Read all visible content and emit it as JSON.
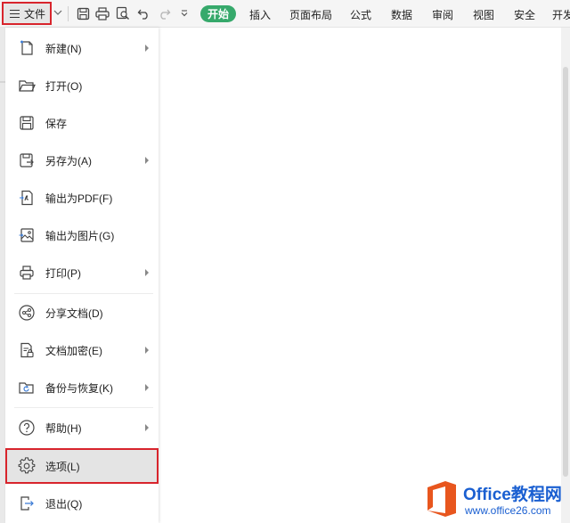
{
  "toolbar": {
    "file_label": "文件",
    "start_tab": "开始",
    "tabs": [
      "插入",
      "页面布局",
      "公式",
      "数据",
      "审阅",
      "视图",
      "安全",
      "开发"
    ],
    "quick_access_icons": [
      "save-icon",
      "print-icon",
      "print-preview-icon",
      "undo-icon",
      "redo-icon",
      "customize-arrow-icon"
    ]
  },
  "file_menu": {
    "items": [
      {
        "label": "新建(N)",
        "icon": "new-file-icon",
        "submenu": true
      },
      {
        "label": "打开(O)",
        "icon": "folder-open-icon",
        "submenu": false
      },
      {
        "label": "保存",
        "icon": "save-icon",
        "submenu": false
      },
      {
        "label": "另存为(A)",
        "icon": "save-as-icon",
        "submenu": true
      },
      {
        "label": "输出为PDF(F)",
        "icon": "export-pdf-icon",
        "submenu": false
      },
      {
        "label": "输出为图片(G)",
        "icon": "export-image-icon",
        "submenu": false
      },
      {
        "label": "打印(P)",
        "icon": "print-icon",
        "submenu": true
      },
      {
        "label": "分享文档(D)",
        "icon": "share-icon",
        "submenu": false
      },
      {
        "label": "文档加密(E)",
        "icon": "encrypt-doc-icon",
        "submenu": true
      },
      {
        "label": "备份与恢复(K)",
        "icon": "backup-restore-icon",
        "submenu": true
      },
      {
        "label": "帮助(H)",
        "icon": "help-icon",
        "submenu": true
      },
      {
        "label": "选项(L)",
        "icon": "gear-icon",
        "submenu": false,
        "selected": true
      },
      {
        "label": "退出(Q)",
        "icon": "exit-icon",
        "submenu": false
      }
    ]
  },
  "watermark": {
    "brand": "Office教程网",
    "url": "www.office26.com"
  },
  "colors": {
    "highlight_border": "#d8242c",
    "start_tab_bg": "#36a96b",
    "watermark_blue": "#1a5fd1",
    "watermark_orange": "#e8561e"
  }
}
